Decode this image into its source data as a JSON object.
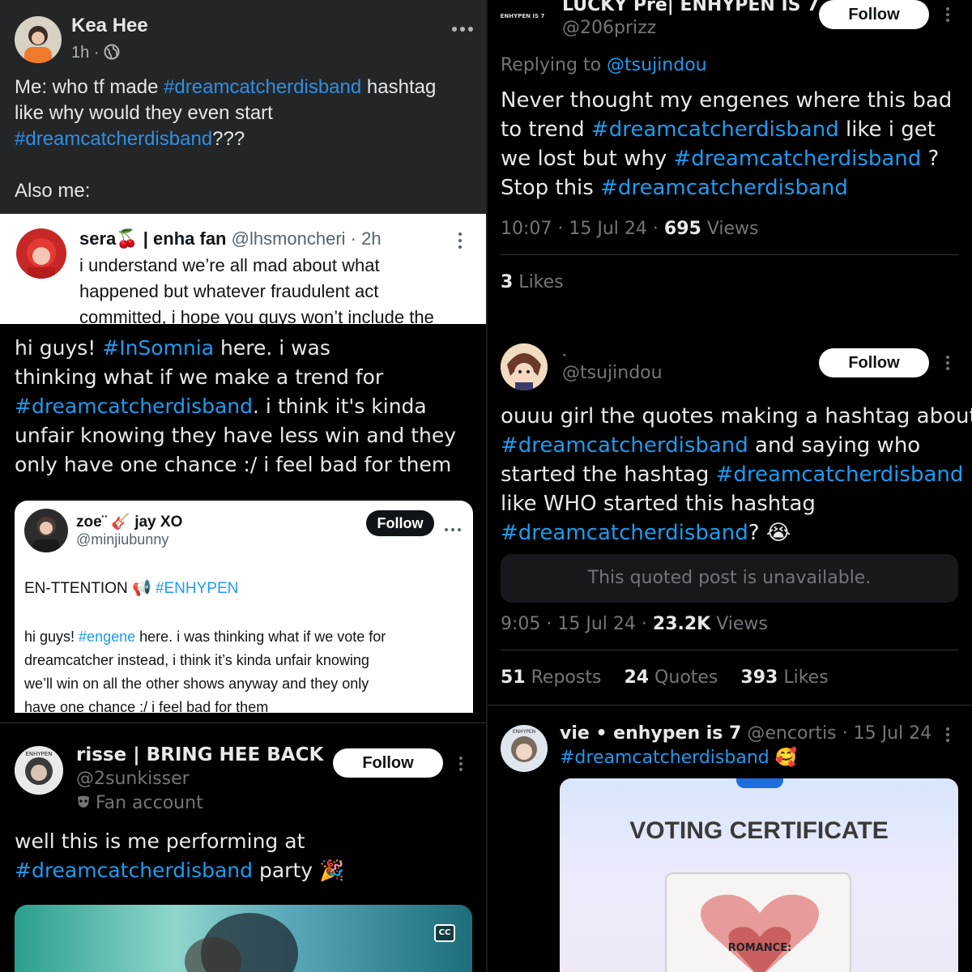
{
  "kea": {
    "name": "Kea Hee",
    "time": "1h ·",
    "line1a": "Me: who tf made ",
    "line1b": "#dreamcatcherdisband",
    "line1c": " hashtag",
    "line2": "like why would they even start",
    "line3a": "#dreamcatcherdisband",
    "line3b": "???",
    "also": "Also me:"
  },
  "sera": {
    "name": "sera🍒 | enha fan",
    "handle": "@lhsmoncheri · 2h",
    "line1": "i understand we’re all mad about what",
    "line2": "happened but whatever fraudulent act",
    "line3": "committed, i hope you guys won’t include the"
  },
  "insomnia": {
    "l1a": "hi guys! ",
    "l1b": "#InSomnia",
    "l1c": " here. i was",
    "l2": "thinking what if we make a trend for",
    "l3a": "#dreamcatcherdisband",
    "l3b": ". i think it's kinda",
    "l4": "unfair knowing they have less win and they",
    "l5": "only have one chance :/ i feel bad for them"
  },
  "zoe": {
    "name": "zoe¨ 🎸 jay XO",
    "handle": "@minjiubunny",
    "follow": "Follow",
    "t1a": "EN-TTENTION 📢 ",
    "t1b": "#ENHYPEN",
    "t2a": "hi guys! ",
    "t2b": "#engene",
    "t2c": " here. i was thinking what if we vote for",
    "t3": "dreamcatcher instead, i think it’s kinda unfair knowing",
    "t4": "we’ll win on all the other shows anyway and they only",
    "t5": "have one chance :/ i feel bad for them"
  },
  "risse": {
    "name": "risse | BRING HEE BACK",
    "handle": "@2sunkisser",
    "badge": "Fan account",
    "follow": "Follow",
    "l1": "well this is me performing at",
    "l2a": "#dreamcatcherdisband",
    "l2b": " party 🎉",
    "cc": "CC"
  },
  "lucky": {
    "avatar_text": "ENHYPEN IS 7",
    "name": "LUCKY Pre| ENHYPEN IS 7",
    "handle": "@206prizz",
    "follow": "Follow",
    "replying": "Replying to ",
    "reply_handle": "@tsujindou",
    "l1": "Never thought my engenes where this bad",
    "l2a": "to trend ",
    "l2b": "#dreamcatcherdisband",
    "l2c": "  like i get",
    "l3a": "we lost but why ",
    "l3b": "#dreamcatcherdisband",
    "l3c": " ?",
    "l4a": "Stop this ",
    "l4b": "#dreamcatcherdisband",
    "meta": "10:07 · 15 Jul 24 · ",
    "views_num": "695",
    "views_label": " Views",
    "likes_num": "3",
    "likes_label": " Likes"
  },
  "tsuji": {
    "name": "ˎ",
    "handle": "@tsujindou",
    "follow": "Follow",
    "l1": "ouuu girl the quotes making a hashtag about",
    "l2a": "#dreamcatcherdisband",
    "l2b": " and saying who",
    "l3a": "started the hashtag ",
    "l3b": "#dreamcatcherdisband",
    "l4": "like WHO started this hashtag",
    "l5a": "#dreamcatcherdisband",
    "l5b": "? 😭",
    "unavailable": "This quoted post is unavailable.",
    "meta": "9:05 · 15 Jul 24 · ",
    "views_num": "23.2K",
    "views_label": " Views",
    "reposts_num": "51",
    "reposts_label": " Reposts",
    "quotes_num": "24",
    "quotes_label": " Quotes",
    "likes_num": "393",
    "likes_label": " Likes"
  },
  "vie": {
    "name": "vie • enhypen is 7",
    "handle": " @encortis · 15 Jul 24",
    "hashtag": "#dreamcatcherdisband",
    "emoji": " 🥰",
    "cert_title": "VOTING CERTIFICATE",
    "album": "ROMANCE:"
  },
  "colors": {
    "link": "#1d9bf0",
    "fb_bg": "#242526"
  }
}
